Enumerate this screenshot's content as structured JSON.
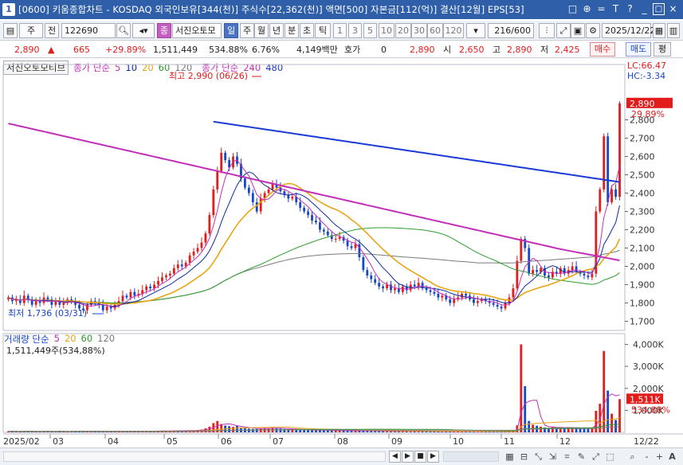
{
  "window": {
    "app_icon": "1",
    "title": "[0600] 키움종합차트 - KOSDAQ 외국인보유[344(천)] 주식수[22,362(천)] 액면[500] 자본금[112(억)] 결산[12월] EPS[53]",
    "buttons": [
      "□",
      "⊕",
      "=",
      "T",
      "?",
      "_",
      "□",
      "×"
    ]
  },
  "toolbar": {
    "mode_label": "주",
    "prev_label": "전",
    "stock_code": "122690",
    "stock_name": "서진오토모",
    "periods": [
      "일",
      "주",
      "월",
      "년",
      "분",
      "초",
      "틱"
    ],
    "active_period": "일",
    "intervals": [
      "1",
      "3",
      "5",
      "10",
      "20",
      "30",
      "60",
      "120"
    ],
    "count": "216/600",
    "date": "2025/12/22"
  },
  "quote": {
    "price": "2,890",
    "arrow": "up",
    "change": "665",
    "change_pct": "+29.89%",
    "volume": "1,511,449",
    "volume_ratio": "534.88%",
    "turnover": "6.76%",
    "amount": "4,149백만",
    "hoga_label": "호가",
    "hoga": "0",
    "hoga_price": "2,890",
    "open_label": "시",
    "open": "2,650",
    "high_label": "고",
    "high": "2,890",
    "low_label": "저",
    "low": "2,425",
    "buy_label": "매수",
    "sell_label": "매도",
    "pyeong_label": "평"
  },
  "price_legend": {
    "name": "서진오토모티브",
    "ma_label": "종가 단순",
    "ma_periods": [
      "5",
      "10",
      "20",
      "60",
      "120"
    ],
    "ma2_label": "종가 단순",
    "ma2_periods": [
      "240",
      "480"
    ],
    "lc": "LC:66.47",
    "hc": "HC:-3.34",
    "high_mark": "최고 2,990 (06/26)",
    "low_mark": "최저 1,736 (03/31)",
    "last_price": "2,890",
    "last_pct": "29.89%"
  },
  "volume_legend": {
    "label": "거래량 단순",
    "periods": [
      "5",
      "20",
      "60",
      "120"
    ],
    "value": "1,511,449주(534,88%)",
    "last_value": "1,511K",
    "last_pct": "534,88%"
  },
  "colors": {
    "up": "#e21b1b",
    "down": "#1746c7",
    "ma5": "#c22fb6",
    "ma10": "#0d2b9e",
    "ma20": "#e8a514",
    "ma60": "#2e9b2e",
    "ma120": "#7a7a7a",
    "ma240": "#c22fb6",
    "ma480": "#1b3bd6"
  },
  "chart_data": {
    "type": "candlestick",
    "ylim": [
      1650,
      3050
    ],
    "yticks": [
      1700,
      1800,
      1900,
      2000,
      2100,
      2200,
      2300,
      2400,
      2500,
      2600,
      2700,
      2800
    ],
    "ytick_labels": [
      "1,700",
      "1,800",
      "1,900",
      "2,000",
      "2,100",
      "2,200",
      "2,300",
      "2,400",
      "2,500",
      "2,600",
      "2,700",
      "2,800"
    ],
    "x_labels": [
      "2025/02",
      "03",
      "04",
      "05",
      "06",
      "07",
      "08",
      "09",
      "10",
      "11",
      "12",
      "12/22"
    ],
    "close": [
      1830,
      1810,
      1820,
      1800,
      1840,
      1820,
      1790,
      1810,
      1800,
      1830,
      1820,
      1790,
      1810,
      1790,
      1800,
      1820,
      1810,
      1790,
      1770,
      1760,
      1790,
      1810,
      1800,
      1790,
      1760,
      1780,
      1770,
      1790,
      1810,
      1840,
      1830,
      1860,
      1840,
      1850,
      1870,
      1890,
      1880,
      1900,
      1920,
      1940,
      1950,
      1960,
      1990,
      2010,
      2000,
      2020,
      2060,
      2080,
      2100,
      2130,
      2180,
      2280,
      2420,
      2520,
      2620,
      2580,
      2540,
      2600,
      2560,
      2480,
      2430,
      2400,
      2350,
      2300,
      2370,
      2400,
      2420,
      2450,
      2430,
      2410,
      2390,
      2370,
      2380,
      2350,
      2320,
      2300,
      2280,
      2250,
      2240,
      2200,
      2190,
      2170,
      2150,
      2150,
      2160,
      2140,
      2110,
      2100,
      2120,
      2050,
      1980,
      1950,
      1930,
      1910,
      1890,
      1880,
      1900,
      1870,
      1880,
      1860,
      1890,
      1870,
      1900,
      1890,
      1910,
      1880,
      1870,
      1860,
      1850,
      1830,
      1840,
      1820,
      1800,
      1820,
      1830,
      1850,
      1840,
      1820,
      1800,
      1810,
      1820,
      1810,
      1800,
      1790,
      1780,
      1770,
      1800,
      1830,
      1880,
      2030,
      2150,
      2100,
      1960,
      1980,
      1970,
      1990,
      1950,
      1940,
      1970,
      1960,
      1990,
      1960,
      1980,
      2000,
      1970,
      1960,
      1950,
      1940,
      1960,
      2300,
      2420,
      2710,
      2350,
      2420,
      2380,
      2890
    ],
    "volume_k": [
      45,
      40,
      38,
      42,
      55,
      40,
      35,
      38,
      36,
      50,
      42,
      38,
      40,
      45,
      42,
      39,
      41,
      44,
      48,
      50,
      46,
      43,
      44,
      47,
      52,
      49,
      45,
      43,
      48,
      55,
      50,
      52,
      47,
      49,
      53,
      58,
      55,
      60,
      62,
      70,
      68,
      72,
      75,
      80,
      70,
      78,
      90,
      95,
      110,
      130,
      180,
      260,
      420,
      520,
      380,
      310,
      280,
      250,
      300,
      220,
      190,
      170,
      160,
      150,
      180,
      200,
      190,
      210,
      180,
      170,
      150,
      140,
      150,
      130,
      120,
      110,
      100,
      95,
      90,
      100,
      95,
      90,
      85,
      80,
      82,
      78,
      70,
      68,
      72,
      80,
      75,
      68,
      65,
      60,
      58,
      55,
      60,
      52,
      55,
      50,
      58,
      52,
      55,
      50,
      60,
      55,
      52,
      48,
      46,
      44,
      45,
      42,
      40,
      43,
      44,
      50,
      46,
      42,
      40,
      41,
      43,
      42,
      40,
      39,
      38,
      37,
      50,
      60,
      95,
      320,
      4000,
      2100,
      520,
      350,
      300,
      260,
      220,
      200,
      240,
      210,
      230,
      190,
      210,
      230,
      200,
      180,
      170,
      160,
      190,
      980,
      1300,
      3700,
      1900,
      850,
      560,
      1511
    ]
  },
  "scrollbar": {
    "buttons": [
      "◀",
      "▶",
      "■",
      "▶",
      "▶"
    ],
    "zoom": [
      "-",
      "+",
      "A"
    ]
  }
}
